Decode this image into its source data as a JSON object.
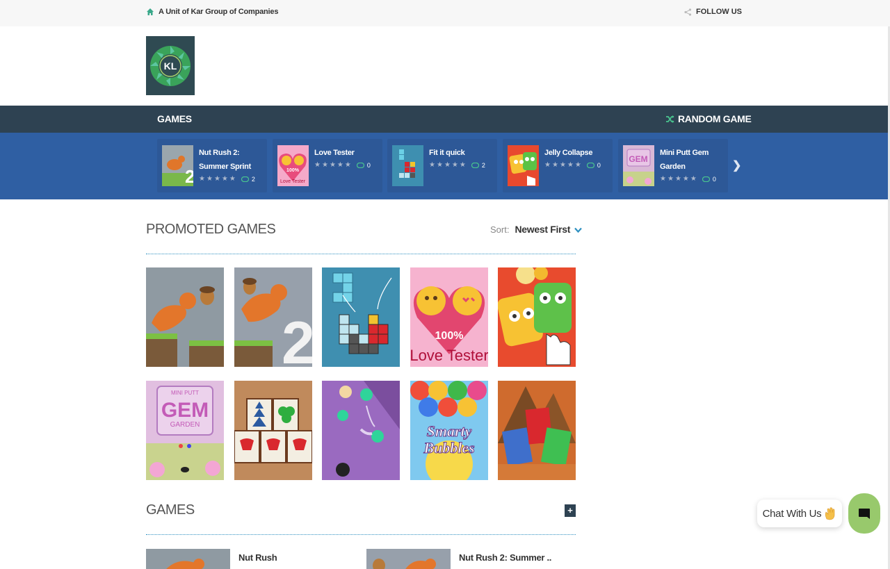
{
  "topbar": {
    "tagline": "A Unit of Kar Group of Companies",
    "follow": "FOLLOW US"
  },
  "logo": {
    "letters": "KL"
  },
  "nav": {
    "games": "GAMES",
    "random": "RANDOM GAME"
  },
  "strip": {
    "cards": [
      {
        "title": "Nut Rush 2: Summer Sprint",
        "plays": "2"
      },
      {
        "title": "Love Tester",
        "plays": "0"
      },
      {
        "title": "Fit it quick",
        "plays": "2"
      },
      {
        "title": "Jelly Collapse",
        "plays": "0"
      },
      {
        "title": "Mini Putt Gem Garden",
        "plays": "0"
      }
    ]
  },
  "promoted": {
    "title": "PROMOTED GAMES",
    "sort_label": "Sort:",
    "sort_value": "Newest First"
  },
  "tile_texts": {
    "love_pct": "100%",
    "love_name": "Love Tester",
    "gem_top": "MINI PUTT",
    "gem_word": "GEM",
    "gem_garden": "GARDEN",
    "smarty_1": "Smarty",
    "smarty_2": "Bubbles",
    "num2": "2"
  },
  "games": {
    "title": "GAMES",
    "plus": "+",
    "items": [
      "Nut Rush",
      "Nut Rush 2: Summer .."
    ]
  },
  "chat": {
    "label": "Chat With Us"
  },
  "colors": {
    "navbar": "#2e4252",
    "strip": "#2f5fa3",
    "accent": "#2d8fc0",
    "chat": "#98c96c"
  }
}
